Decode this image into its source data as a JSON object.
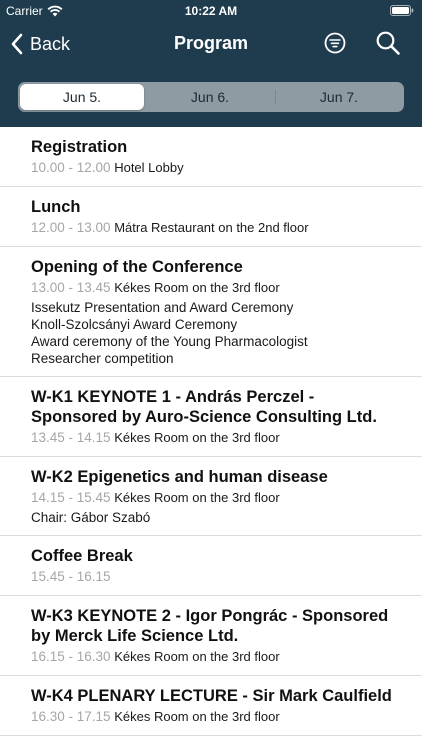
{
  "status_bar": {
    "carrier": "Carrier",
    "time": "10:22 AM"
  },
  "nav": {
    "back_label": "Back",
    "title": "Program"
  },
  "icons": {
    "back": "chevron-left-icon",
    "filter": "filter-icon",
    "search": "search-icon",
    "wifi": "wifi-icon",
    "battery": "battery-icon"
  },
  "colors": {
    "header_bg": "#1f3c4e",
    "time_text": "#a6a6aa",
    "separator": "#dcdce0"
  },
  "tabs": [
    {
      "label": "Jun 5.",
      "selected": true
    },
    {
      "label": "Jun 6.",
      "selected": false
    },
    {
      "label": "Jun 7.",
      "selected": false
    }
  ],
  "sessions": [
    {
      "title": "Registration",
      "time": "10.00 - 12.00",
      "location": "Hotel Lobby",
      "extra": []
    },
    {
      "title": "Lunch",
      "time": "12.00 - 13.00",
      "location": "Mátra Restaurant on the 2nd floor",
      "extra": []
    },
    {
      "title": "Opening of the Conference",
      "time": "13.00 - 13.45",
      "location": "Kékes Room on the 3rd floor",
      "extra": [
        "Issekutz Presentation and Award Ceremony",
        "Knoll-Szolcsányi Award Ceremony",
        "Award ceremony of the Young Pharmacologist",
        "Researcher competition"
      ]
    },
    {
      "title": "W-K1 KEYNOTE 1 - András Perczel - Sponsored by Auro-Science Consulting Ltd.",
      "time": "13.45 - 14.15",
      "location": "Kékes Room on the 3rd floor",
      "extra": []
    },
    {
      "title": "W-K2 Epigenetics and human disease",
      "time": "14.15 - 15.45",
      "location": "Kékes Room on the 3rd floor",
      "extra": [
        "Chair: Gábor Szabó"
      ]
    },
    {
      "title": "Coffee Break",
      "time": "15.45 - 16.15",
      "location": "",
      "extra": []
    },
    {
      "title": "W-K3 KEYNOTE 2 - Igor Pongrác - Sponsored by Merck Life Science Ltd.",
      "time": "16.15 - 16.30",
      "location": "Kékes Room on the 3rd floor",
      "extra": []
    },
    {
      "title": "W-K4 PLENARY LECTURE - Sir Mark Caulfield",
      "time": "16.30 - 17.15",
      "location": "Kékes Room on the 3rd floor",
      "extra": []
    }
  ]
}
